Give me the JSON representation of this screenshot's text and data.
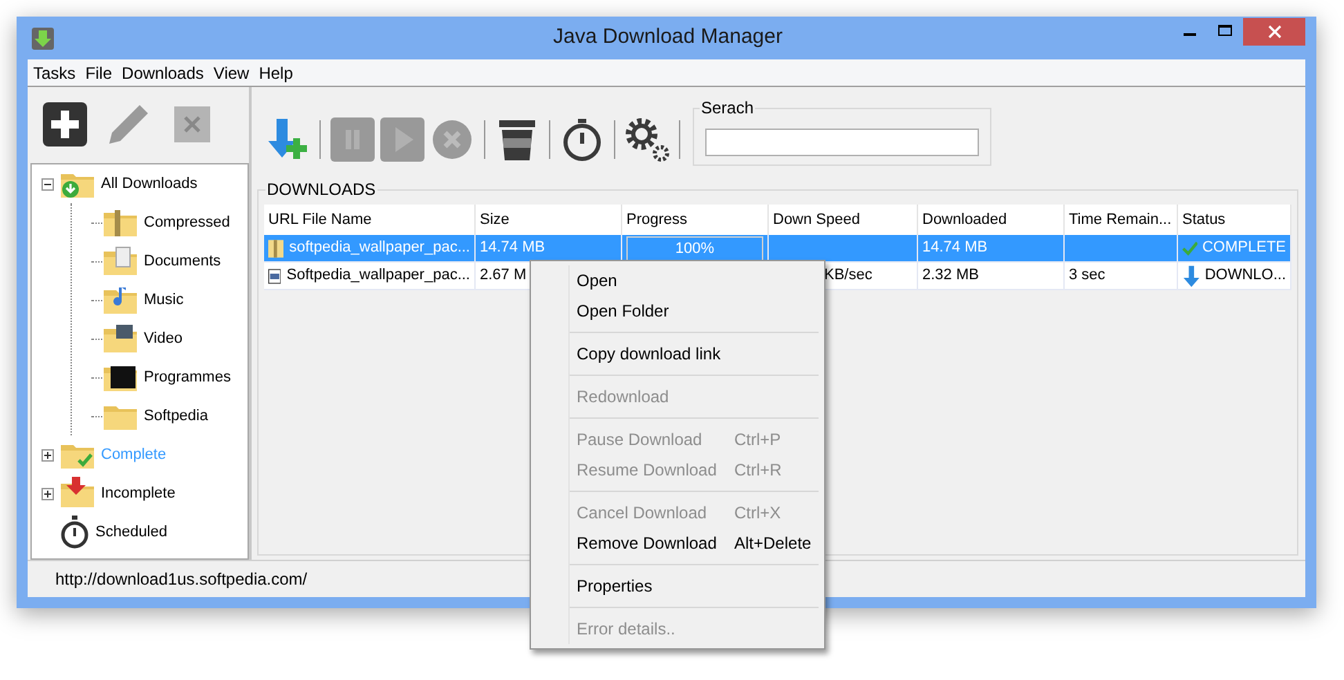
{
  "window": {
    "title": "Java Download Manager"
  },
  "menu_bar": [
    "Tasks",
    "File",
    "Downloads",
    "View",
    "Help"
  ],
  "side_toolbar": [
    {
      "kind": "add",
      "disabled": false
    },
    {
      "kind": "edit",
      "disabled": true
    },
    {
      "kind": "delete",
      "disabled": true
    }
  ],
  "toolbar": [
    {
      "kind": "add-download",
      "disabled": false
    },
    {
      "kind": "pause",
      "disabled": true
    },
    {
      "kind": "play",
      "disabled": true
    },
    {
      "kind": "cancel",
      "disabled": true
    },
    {
      "kind": "trash",
      "disabled": false
    },
    {
      "kind": "timer",
      "disabled": false
    },
    {
      "kind": "settings",
      "disabled": false
    }
  ],
  "search": {
    "label": "Serach"
  },
  "tree": [
    {
      "label": "All Downloads",
      "kind": "all",
      "expanded": true,
      "selected": false,
      "children": [
        {
          "label": "Compressed",
          "kind": "compressed",
          "selected": false
        },
        {
          "label": "Documents",
          "kind": "documents",
          "selected": false
        },
        {
          "label": "Music",
          "kind": "music",
          "selected": false
        },
        {
          "label": "Video",
          "kind": "video",
          "selected": false
        },
        {
          "label": "Programmes",
          "kind": "programmes",
          "selected": false
        },
        {
          "label": "Softpedia",
          "kind": "folder",
          "selected": false
        }
      ]
    },
    {
      "label": "Complete",
      "kind": "complete",
      "expanded": false,
      "selected": true
    },
    {
      "label": "Incomplete",
      "kind": "incomplete",
      "expanded": false,
      "selected": false
    },
    {
      "label": "Scheduled",
      "kind": "scheduled",
      "selected": false
    }
  ],
  "downloads": {
    "title": "DOWNLOADS",
    "columns": [
      "URL File Name",
      "Size",
      "Progress",
      "Down Speed",
      "Downloaded",
      "Time Remain...",
      "Status"
    ],
    "rows": [
      {
        "selected": true,
        "kind": "archive",
        "name": "softpedia_wallpaper_pac...",
        "size": "14.74 MB",
        "progress": {
          "level": 1,
          "text": "100%"
        },
        "speed": "",
        "downloaded": "14.74 MB",
        "remaining": "",
        "status": {
          "kind": "complete",
          "text": "COMPLETE"
        }
      },
      {
        "selected": false,
        "kind": "document",
        "name": "Softpedia_wallpaper_pac...",
        "size": "2.67 M",
        "speed": "KB/sec",
        "downloaded": "2.32 MB",
        "remaining": "3 sec",
        "status": {
          "kind": "downloading",
          "text": "DOWNLO..."
        }
      }
    ]
  },
  "status_bar": "http://download1us.softpedia.com/",
  "context_menu": [
    [
      {
        "label": "Open",
        "disabled": false
      },
      {
        "label": "Open Folder",
        "disabled": false
      }
    ],
    [
      {
        "label": "Copy download link",
        "disabled": false
      }
    ],
    [
      {
        "label": "Redownload",
        "disabled": true
      }
    ],
    [
      {
        "label": "Pause Download",
        "shortcut": "Ctrl+P",
        "disabled": true
      },
      {
        "label": "Resume Download",
        "shortcut": "Ctrl+R",
        "disabled": true
      }
    ],
    [
      {
        "label": "Cancel Download",
        "shortcut": "Ctrl+X",
        "disabled": true
      },
      {
        "label": "Remove Download",
        "shortcut": "Alt+Delete",
        "disabled": false
      }
    ],
    [
      {
        "label": "Properties",
        "disabled": false
      }
    ],
    [
      {
        "label": "Error details..",
        "disabled": true
      }
    ]
  ]
}
